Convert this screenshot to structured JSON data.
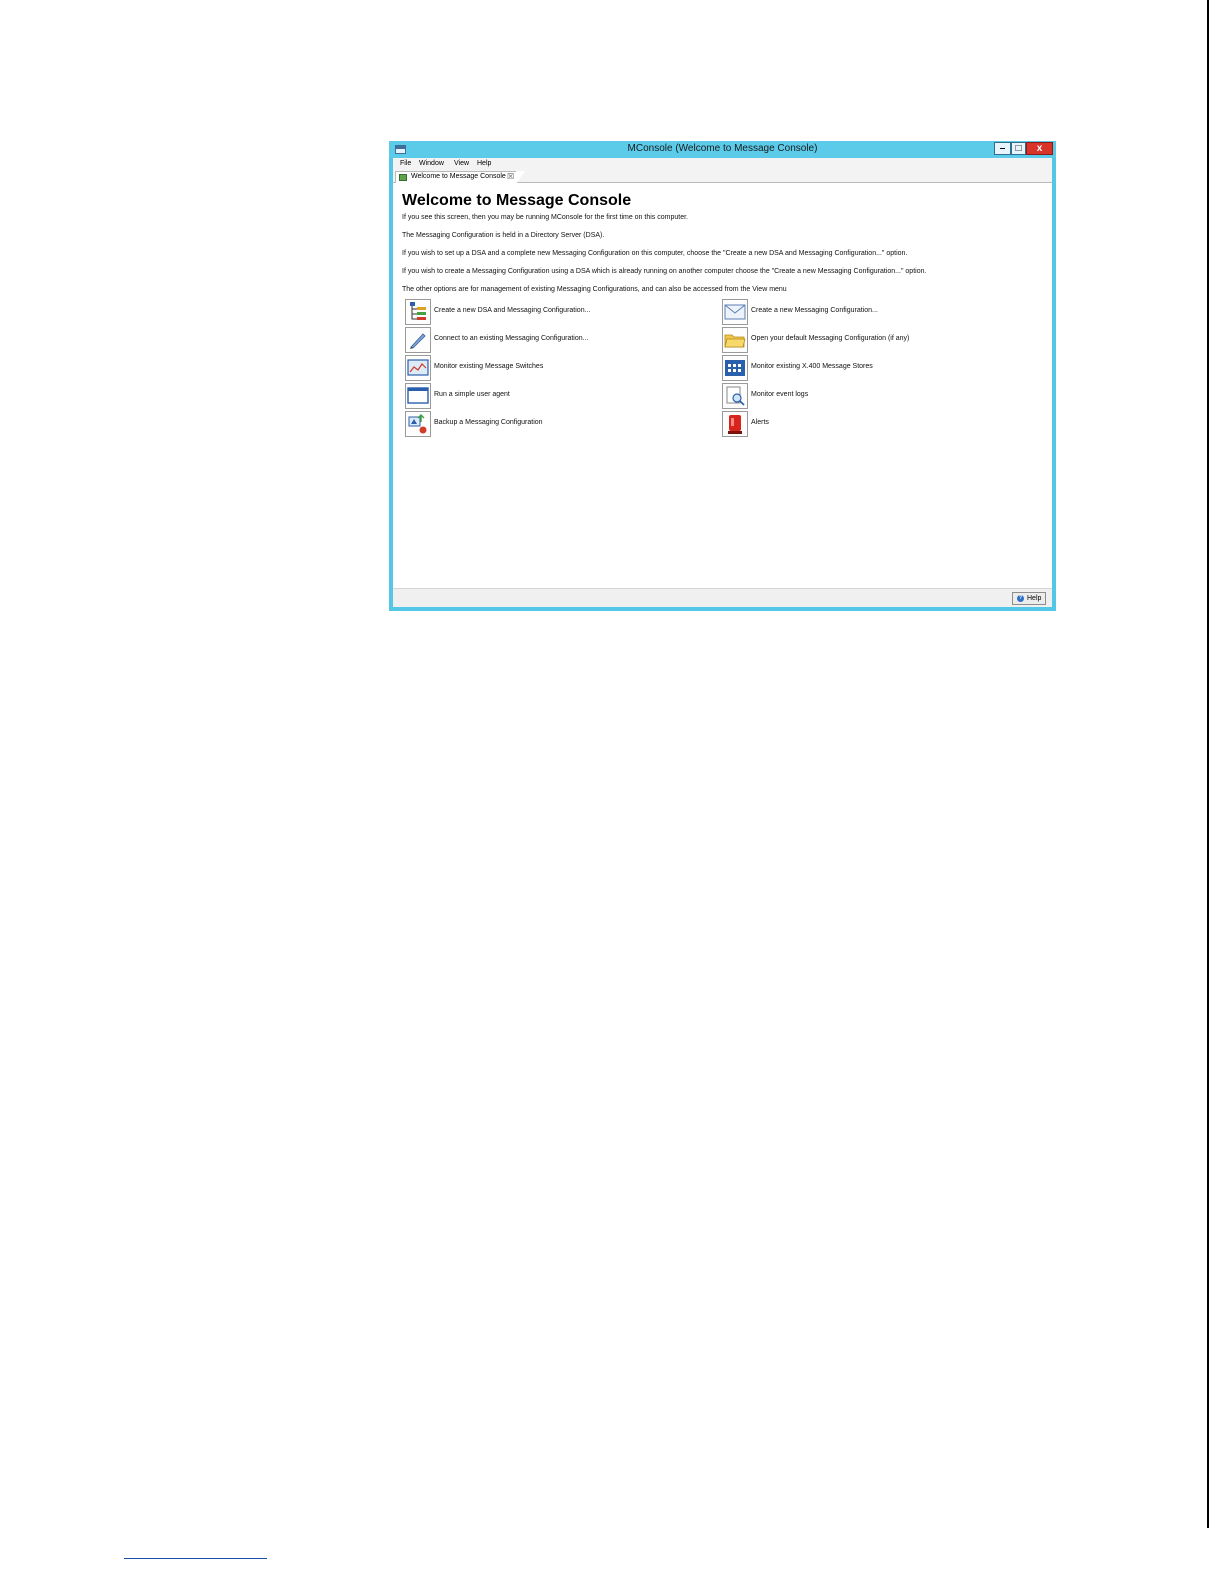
{
  "window": {
    "title": "MConsole (Welcome to Message Console)",
    "controls": {
      "minimize": "–",
      "maximize": "□",
      "close": "x"
    }
  },
  "menu": [
    "File",
    "Window",
    "View",
    "Help"
  ],
  "tab": {
    "label": "Welcome to Message Console",
    "close": "☒"
  },
  "welcome": {
    "heading": "Welcome to Message Console",
    "paragraphs": [
      "If you see this screen, then you may be running MConsole for the first time on this computer.",
      "The Messaging Configuration is held in a Directory Server (DSA).",
      "If you wish to set up a DSA and a complete new Messaging Configuration on this computer, choose the \"Create a new DSA and Messaging Configuration...\" option.",
      "If you wish to create a Messaging Configuration using a DSA which is already running on another computer choose the \"Create a new Messaging Configuration...\" option.",
      "The other options are for management of existing Messaging Configurations, and can also be accessed from the View menu"
    ]
  },
  "options": [
    {
      "label": "Create a new DSA and Messaging Configuration...",
      "icon": "dsa-tree-icon"
    },
    {
      "label": "Create a new Messaging Configuration...",
      "icon": "envelope-icon"
    },
    {
      "label": "Connect to an existing Messaging Configuration...",
      "icon": "connect-pen-icon"
    },
    {
      "label": "Open your default Messaging Configuration (if any)",
      "icon": "folder-icon"
    },
    {
      "label": "Monitor existing Message Switches",
      "icon": "monitor-graph-icon"
    },
    {
      "label": "Monitor existing X.400 Message Stores",
      "icon": "message-store-icon"
    },
    {
      "label": "Run a simple user agent",
      "icon": "window-icon"
    },
    {
      "label": "Monitor event logs",
      "icon": "log-search-icon"
    },
    {
      "label": "Backup a Messaging Configuration",
      "icon": "backup-icon"
    },
    {
      "label": "Alerts",
      "icon": "alert-siren-icon"
    }
  ],
  "status": {
    "help_label": "Help"
  }
}
